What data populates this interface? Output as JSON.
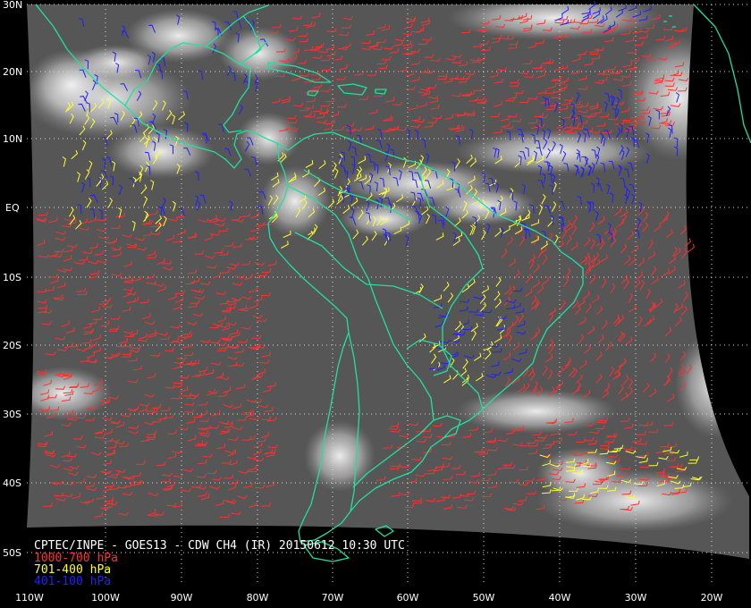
{
  "title": "CPTEC/INPE - GOES13 - CDW CH4 (IR) 20150612 10:30 UTC",
  "legend": [
    {
      "label": "1000-700 hPa",
      "color": "#ff3030"
    },
    {
      "label": "701-400 hPa",
      "color": "#ffff30"
    },
    {
      "label": "401-100 hPa",
      "color": "#2020ff"
    }
  ],
  "lat_labels": [
    "30N",
    "20N",
    "10N",
    "EQ",
    "10S",
    "20S",
    "30S",
    "40S",
    "50S"
  ],
  "lon_labels": [
    "110W",
    "100W",
    "90W",
    "80W",
    "70W",
    "60W",
    "50W",
    "40W",
    "30W",
    "20W"
  ],
  "colors": {
    "coastline": "#20e0a0",
    "grid": "#d8d8d8",
    "background": "#000000"
  }
}
